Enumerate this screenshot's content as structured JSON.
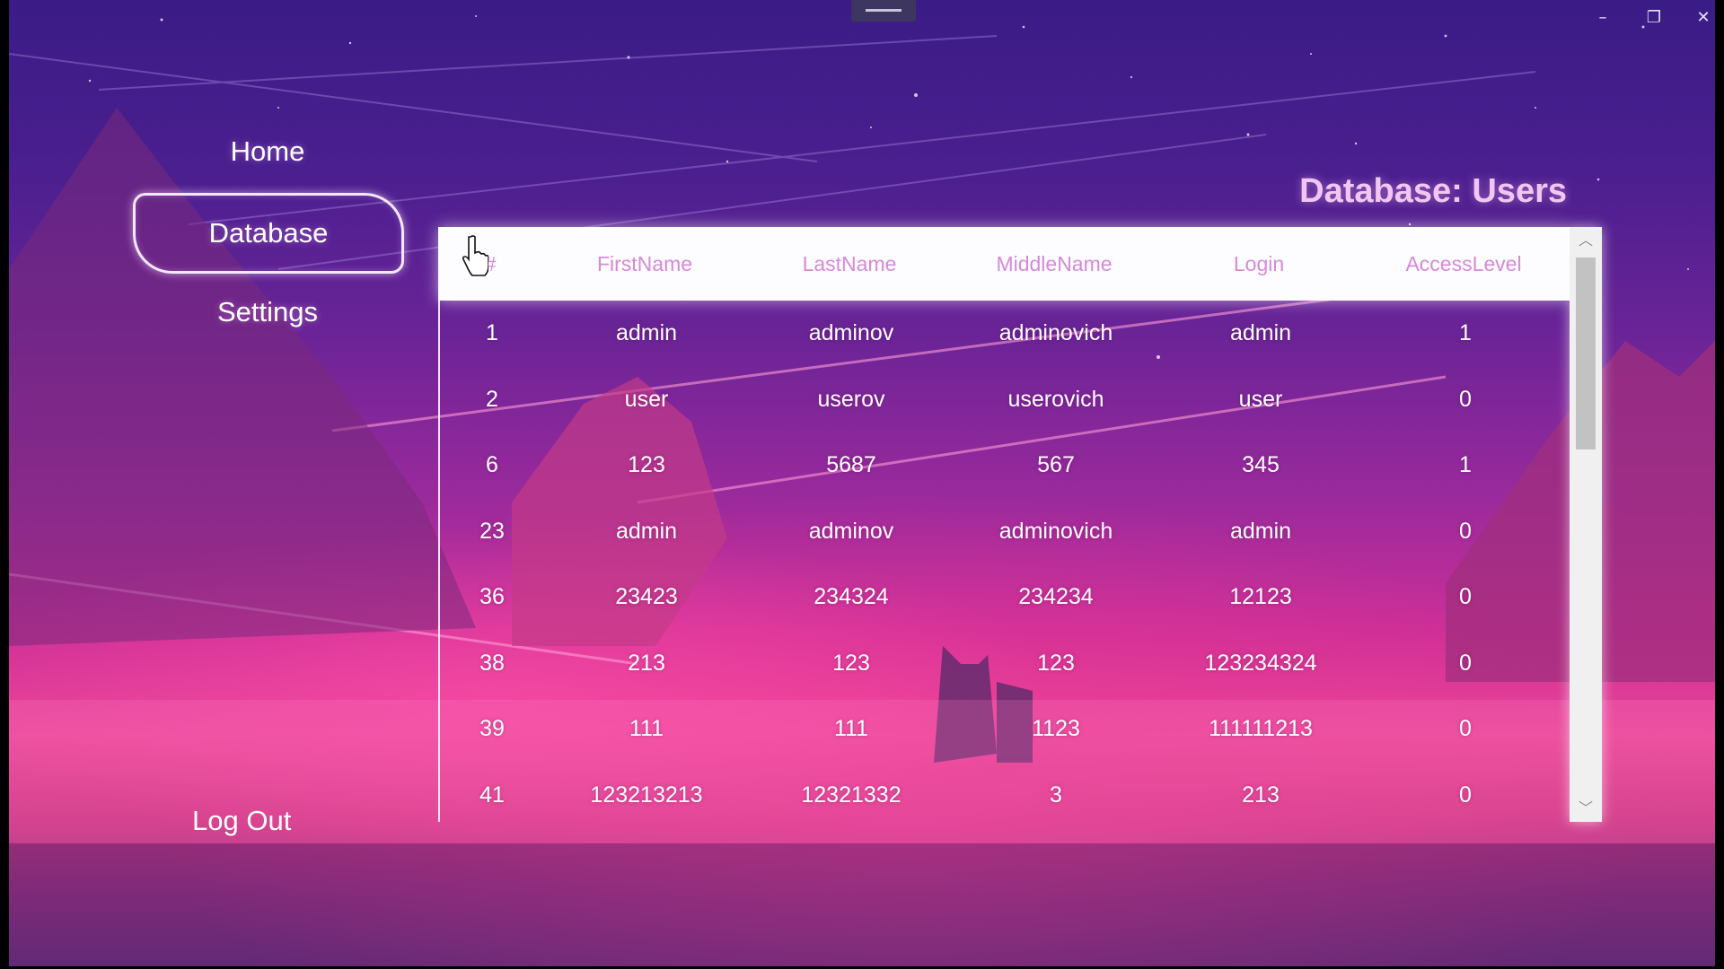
{
  "window": {
    "controls": {
      "minimize": "–",
      "maximize": "❐",
      "close": "✕"
    }
  },
  "nav": {
    "items": [
      {
        "label": "Home",
        "active": false
      },
      {
        "label": "Database",
        "active": true
      },
      {
        "label": "Settings",
        "active": false
      }
    ],
    "logout_label": "Log Out"
  },
  "page_title": "Database: Users",
  "table": {
    "columns": [
      "#",
      "FirstName",
      "LastName",
      "MiddleName",
      "Login",
      "AccessLevel"
    ],
    "rows": [
      [
        "1",
        "admin",
        "adminov",
        "adminovich",
        "admin",
        "1"
      ],
      [
        "2",
        "user",
        "userov",
        "userovich",
        "user",
        "0"
      ],
      [
        "6",
        "123",
        "5687",
        "567",
        "345",
        "1"
      ],
      [
        "23",
        "admin",
        "adminov",
        "adminovich",
        "admin",
        "0"
      ],
      [
        "36",
        "23423",
        "234324",
        "234234",
        "12123",
        "0"
      ],
      [
        "38",
        "213",
        "123",
        "123",
        "123234324",
        "0"
      ],
      [
        "39",
        "111",
        "111",
        "1123",
        "111111213",
        "0"
      ],
      [
        "41",
        "123213213",
        "12321332",
        "3",
        "213",
        "0"
      ]
    ]
  },
  "colors": {
    "header_text": "#d58ad8",
    "title_text": "#f2c6f0",
    "accent_border": "#f3e8ff"
  },
  "icons": {
    "scroll_up": "chevron-up-icon",
    "scroll_down": "chevron-down-icon",
    "cursor": "hand-pointer-icon"
  }
}
